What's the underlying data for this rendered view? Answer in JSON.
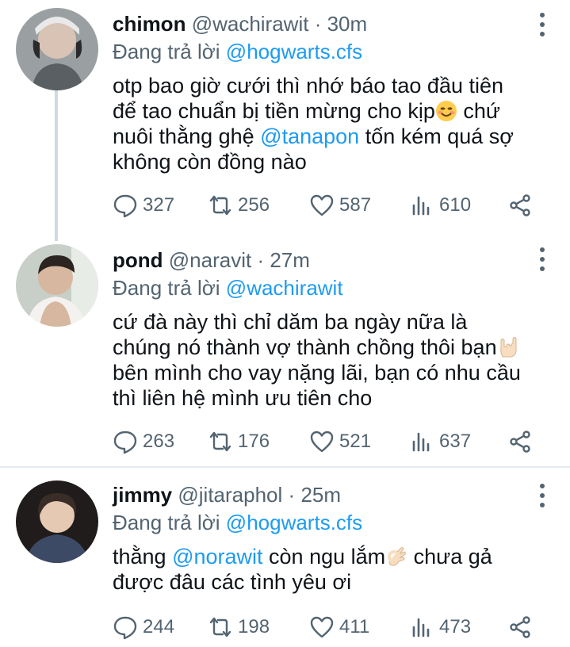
{
  "tweets": [
    {
      "name": "chimon",
      "handle": "@wachirawit",
      "dot": "·",
      "time": "30m",
      "reply_prefix": "Đang trả lời",
      "reply_to": "@hogwarts.cfs",
      "body": {
        "t1": "otp bao giờ cưới thì nhớ báo tao đầu tiên để tao chuẩn bị tiền mừng cho kịp",
        "t2": " chứ nuôi thằng ghệ ",
        "mention": "@tanapon",
        "t3": " tốn kém quá sợ không còn đồng nào"
      },
      "emoji": "smiling-face-emoji",
      "counts": {
        "replies": "327",
        "retweets": "256",
        "likes": "587",
        "views": "610"
      }
    },
    {
      "name": "pond",
      "handle": "@naravit",
      "dot": "·",
      "time": "27m",
      "reply_prefix": "Đang trả lời",
      "reply_to": "@wachirawit",
      "body": {
        "t1": "cứ đà này thì chỉ dăm ba ngày nữa là chúng nó thành vợ thành chồng thôi bạn",
        "t2": " bên mình cho vay nặng lãi, bạn có nhu cầu thì liên hệ mình ưu tiên cho"
      },
      "emoji": "love-you-gesture-emoji",
      "counts": {
        "replies": "263",
        "retweets": "176",
        "likes": "521",
        "views": "637"
      }
    },
    {
      "name": "jimmy",
      "handle": "@jitaraphol",
      "dot": "·",
      "time": "25m",
      "reply_prefix": "Đang trả lời",
      "reply_to": "@hogwarts.cfs",
      "body": {
        "t1": "thằng ",
        "mention": "@norawit",
        "t2": " còn ngu lắm",
        "t3": " chưa gả được đâu các tình yêu ơi"
      },
      "emoji": "ok-hand-emoji",
      "counts": {
        "replies": "244",
        "retweets": "198",
        "likes": "411",
        "views": "473"
      }
    }
  ],
  "icons": {
    "reply": "speech-bubble-icon",
    "retweet": "retweet-icon",
    "like": "heart-icon",
    "views": "bar-chart-icon",
    "share": "share-icon",
    "more": "vertical-dots-icon"
  },
  "colors": {
    "link": "#1d9bf0",
    "secondary_text": "#536471",
    "primary_text": "#0f1419",
    "thread_line": "#cfd9de"
  }
}
